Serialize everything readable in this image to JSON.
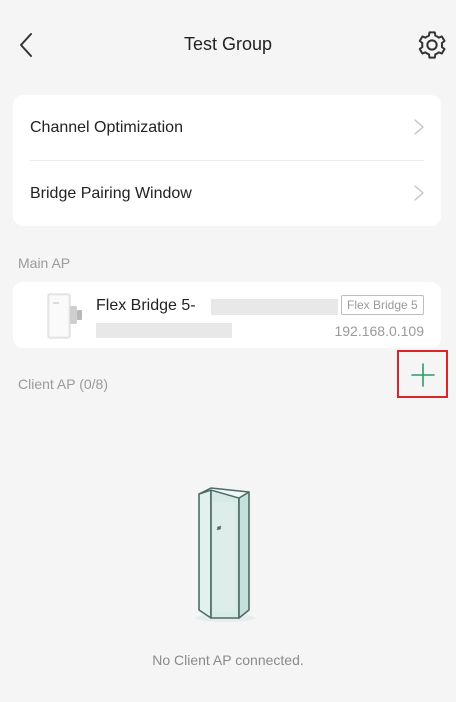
{
  "header": {
    "title": "Test Group"
  },
  "settings_list": {
    "items": [
      {
        "label": "Channel Optimization"
      },
      {
        "label": "Bridge Pairing Window"
      }
    ]
  },
  "main_ap": {
    "section_label": "Main AP",
    "device": {
      "name": "Flex Bridge 5-",
      "model": "Flex Bridge 5",
      "ip": "192.168.0.109"
    }
  },
  "client_ap": {
    "section_label": "Client AP (0/8)",
    "empty_text": "No Client AP connected."
  },
  "colors": {
    "accent_green": "#2a9d63",
    "highlight_red": "#d9252c"
  },
  "icons": {
    "back": "chevron-left-icon",
    "settings": "gear-icon",
    "row_chevron": "chevron-right-icon",
    "add": "plus-icon"
  }
}
